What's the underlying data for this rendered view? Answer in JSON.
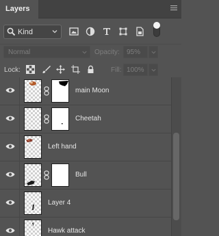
{
  "panel": {
    "tab_label": "Layers"
  },
  "filter": {
    "kind_label": "Kind",
    "icons": [
      "image-filter-icon",
      "adjustment-filter-icon",
      "type-filter-icon",
      "shape-filter-icon",
      "smart-object-filter-icon"
    ],
    "toggle_on": true
  },
  "blend": {
    "mode": "Normal",
    "opacity_label": "Opacity:",
    "opacity_value": "95%"
  },
  "lock": {
    "label": "Lock:",
    "icons": [
      "lock-transparent-pixels-icon",
      "lock-image-pixels-icon",
      "lock-position-icon",
      "lock-artboard-icon",
      "lock-all-icon"
    ],
    "fill_label": "Fill:",
    "fill_value": "100%"
  },
  "layers": [
    {
      "name": "main Moon",
      "visible": true,
      "has_mask": true
    },
    {
      "name": "Cheetah",
      "visible": true,
      "has_mask": true
    },
    {
      "name": "Left hand",
      "visible": true,
      "has_mask": false
    },
    {
      "name": "Bull",
      "visible": true,
      "has_mask": true
    },
    {
      "name": "Layer 4",
      "visible": true,
      "has_mask": false
    },
    {
      "name": "Hawk attack",
      "visible": true,
      "has_mask": false
    }
  ],
  "colors": {
    "panel_bg": "#535353",
    "tab_bar_bg": "#424242",
    "text": "#e6e6e6",
    "disabled_text": "#7e7e7e"
  }
}
